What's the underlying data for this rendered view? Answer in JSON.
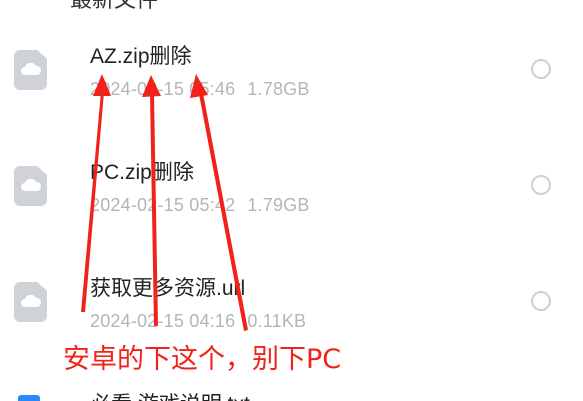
{
  "partial_header": "最新文件",
  "files": [
    {
      "name": "AZ.zip删除",
      "date": "2024-02-15 05:46",
      "size": "1.78GB"
    },
    {
      "name": "PC.zip删除",
      "date": "2024-02-15 05:42",
      "size": "1.79GB"
    },
    {
      "name": "获取更多资源.url",
      "date": "2024-02-15 04:16",
      "size": "0.11KB"
    },
    {
      "name": "必看 游戏说明.txt"
    }
  ],
  "annotation": "安卓的下这个，别下PC",
  "colors": {
    "annotation_red": "#f0221a",
    "meta_gray": "#b2b5bb",
    "icon_gray": "#cfd3d8",
    "accent_blue": "#2b8af7"
  },
  "icons": {
    "file": "cloud-file-icon",
    "txt": "text-file-icon",
    "select": "radio-circle-icon"
  }
}
